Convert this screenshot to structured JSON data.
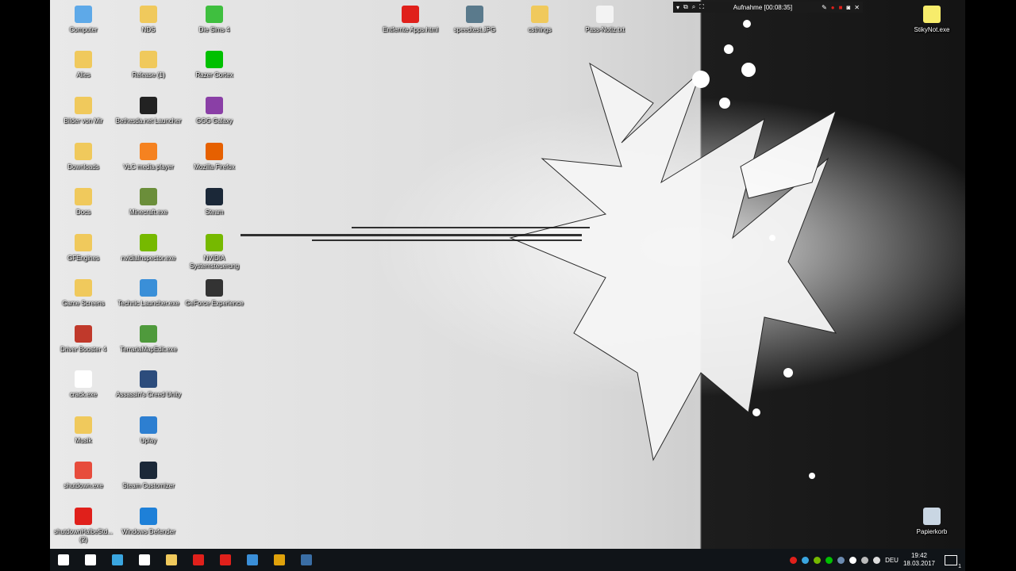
{
  "desktop": {
    "icons_left": [
      {
        "label": "Computer",
        "icon": "computer-icon",
        "color": "#5ea9e8"
      },
      {
        "label": "Alles",
        "icon": "folder-icon",
        "color": "#f0c95c"
      },
      {
        "label": "Bilder von Mir",
        "icon": "folder-icon",
        "color": "#f0c95c"
      },
      {
        "label": "Downloads",
        "icon": "downloads-folder-icon",
        "color": "#f0c95c"
      },
      {
        "label": "Docs",
        "icon": "folder-icon",
        "color": "#f0c95c"
      },
      {
        "label": "GFEngines",
        "icon": "folder-icon",
        "color": "#f0c95c"
      },
      {
        "label": "Game Screens",
        "icon": "folder-icon",
        "color": "#f0c95c"
      },
      {
        "label": "Driver Booster 4",
        "icon": "driver-booster-icon",
        "color": "#c0392b"
      },
      {
        "label": "crack.exe",
        "icon": "hat-icon",
        "color": "#ffffff"
      },
      {
        "label": "Musik",
        "icon": "music-folder-icon",
        "color": "#f0c95c"
      },
      {
        "label": "shutdown.exe",
        "icon": "shutdown-icon",
        "color": "#e74c3c"
      },
      {
        "label": "shutdownHalbeStd... (2)",
        "icon": "red-x-icon",
        "color": "#e0201b"
      }
    ],
    "icons_mid": [
      {
        "label": "NDS",
        "icon": "folder-icon",
        "color": "#f0c95c"
      },
      {
        "label": "Release (1)",
        "icon": "folder-icon",
        "color": "#f0c95c"
      },
      {
        "label": "Bethesda.net Launcher",
        "icon": "bethesda-icon",
        "color": "#222222"
      },
      {
        "label": "VLC media player",
        "icon": "vlc-icon",
        "color": "#f58220"
      },
      {
        "label": "Minecraft.exe",
        "icon": "minecraft-icon",
        "color": "#6b8e3a"
      },
      {
        "label": "nvidiaInspector.exe",
        "icon": "nvidia-inspector-icon",
        "color": "#76b900"
      },
      {
        "label": "Technic Launcher.exe",
        "icon": "technic-icon",
        "color": "#3a8fd8"
      },
      {
        "label": "TerrariaMapEdit.exe",
        "icon": "terraria-tree-icon",
        "color": "#4f9a3c"
      },
      {
        "label": "Assassin's Creed Unity",
        "icon": "assassins-creed-icon",
        "color": "#2c4c7c"
      },
      {
        "label": "Uplay",
        "icon": "uplay-icon",
        "color": "#2d7fd1"
      },
      {
        "label": "Steam Customizer",
        "icon": "steam-customizer-icon",
        "color": "#1b2838"
      },
      {
        "label": "Windows Defender",
        "icon": "windows-defender-icon",
        "color": "#1e80d8"
      }
    ],
    "icons_right": [
      {
        "label": "Die Sims 4",
        "icon": "sims-icon",
        "color": "#3fbf3f"
      },
      {
        "label": "Razer Cortex",
        "icon": "razer-cortex-icon",
        "color": "#00c000"
      },
      {
        "label": "GOG Galaxy",
        "icon": "gog-icon",
        "color": "#8a3fa6"
      },
      {
        "label": "Mozilla Firefox",
        "icon": "firefox-icon",
        "color": "#e66000"
      },
      {
        "label": "Steam",
        "icon": "steam-icon",
        "color": "#1b2838"
      },
      {
        "label": "NVIDIA Systemsteuerung",
        "icon": "nvidia-icon",
        "color": "#76b900"
      },
      {
        "label": "GeForce Experience",
        "icon": "geforce-icon",
        "color": "#333333"
      }
    ],
    "icons_top": [
      {
        "label": "Entfernte Apps.html",
        "icon": "opera-icon",
        "color": "#e0201b"
      },
      {
        "label": "speedtest.JPG",
        "icon": "image-file-icon",
        "color": "#5a7a8c"
      },
      {
        "label": "csthings",
        "icon": "folder-icon",
        "color": "#f0c95c"
      },
      {
        "label": "Pass-Notiz.txt",
        "icon": "text-file-icon",
        "color": "#f3f3f3"
      }
    ],
    "icons_far_right": [
      {
        "label": "StikyNot.exe",
        "icon": "sticky-notes-icon",
        "color": "#f7ec6b"
      },
      {
        "label": "Papierkorb",
        "icon": "recycle-bin-icon",
        "color": "#c9d6e3"
      }
    ]
  },
  "recording_bar": {
    "title": "Aufnahme [00:08:35]"
  },
  "taskbar": {
    "apps": [
      {
        "icon": "start-icon",
        "color": "#ffffff"
      },
      {
        "icon": "task-view-icon",
        "color": "#ffffff"
      },
      {
        "icon": "network-app-icon",
        "color": "#3aa6e0"
      },
      {
        "icon": "store-icon",
        "color": "#ffffff"
      },
      {
        "icon": "file-explorer-icon",
        "color": "#f0c95c"
      },
      {
        "icon": "record-icon",
        "color": "#e0201b"
      },
      {
        "icon": "opera-icon",
        "color": "#e0201b"
      },
      {
        "icon": "technic-launcher-icon",
        "color": "#3a8fd8"
      },
      {
        "icon": "go-app-icon",
        "color": "#e0a20b"
      },
      {
        "icon": "steam-icon",
        "color": "#3a6ea5"
      }
    ],
    "tray": {
      "language": "DEU",
      "time": "19:42",
      "date": "18.03.2017",
      "notification_count": "1"
    }
  }
}
